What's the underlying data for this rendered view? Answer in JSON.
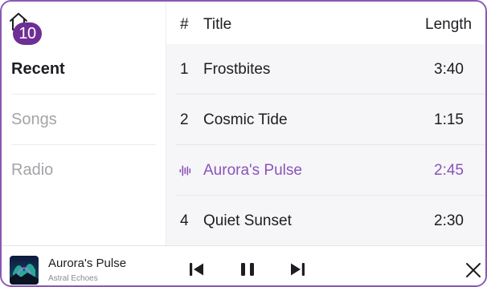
{
  "header": {
    "badge_count": "10"
  },
  "sidebar": {
    "items": [
      {
        "label": "Recent",
        "active": true
      },
      {
        "label": "Songs",
        "active": false
      },
      {
        "label": "Radio",
        "active": false
      }
    ]
  },
  "table": {
    "columns": {
      "number": "#",
      "title": "Title",
      "length": "Length"
    },
    "rows": [
      {
        "number": "1",
        "title": "Frostbites",
        "length": "3:40",
        "playing": false
      },
      {
        "number": "2",
        "title": "Cosmic Tide",
        "length": "1:15",
        "playing": false
      },
      {
        "number": "",
        "title": "Aurora's Pulse",
        "length": "2:45",
        "playing": true
      },
      {
        "number": "4",
        "title": "Quiet Sunset",
        "length": "2:30",
        "playing": false
      }
    ]
  },
  "player": {
    "title": "Aurora's Pulse",
    "artist": "Astral Echoes"
  },
  "colors": {
    "accent": "#8b53b8",
    "badge": "#6f2e95",
    "border": "#8a58b4"
  },
  "icons": {
    "home": "home-icon",
    "playing": "equalizer-icon",
    "previous": "skip-previous-icon",
    "pause": "pause-icon",
    "next": "skip-next-icon",
    "close": "close-icon"
  }
}
